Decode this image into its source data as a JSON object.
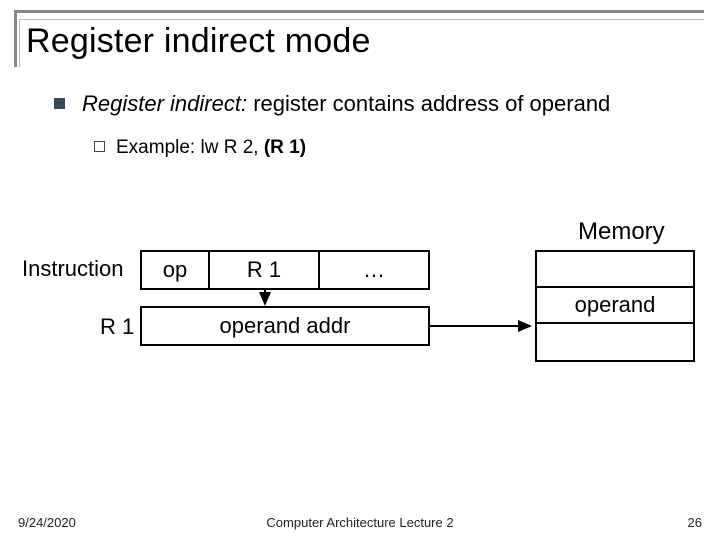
{
  "title": "Register indirect mode",
  "bullet": {
    "lead_italic": "Register indirect:",
    "rest": " register contains address of operand"
  },
  "example": {
    "prefix": "Example:  lw R 2, ",
    "bold_tail": "(R 1)"
  },
  "memory_label": "Memory",
  "labels": {
    "instruction": "Instruction",
    "r1": "R 1"
  },
  "boxes": {
    "op": "op",
    "r1_field": "R 1",
    "dots": "…",
    "reg": "operand addr",
    "mem_operand": "operand"
  },
  "footer": {
    "date": "9/24/2020",
    "center": "Computer Architecture Lecture 2",
    "page": "26"
  }
}
